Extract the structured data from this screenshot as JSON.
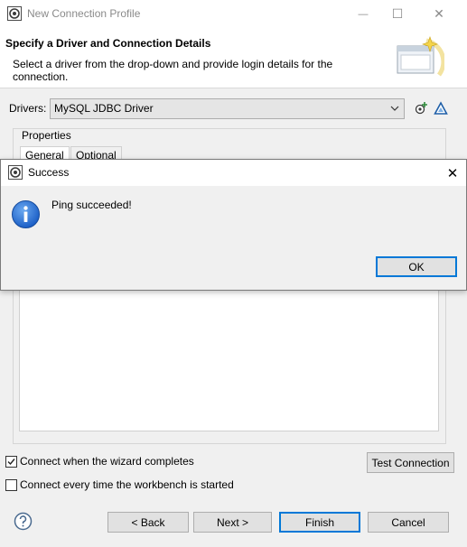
{
  "window": {
    "title": "New Connection Profile",
    "minimize_glyph": "—",
    "maximize_glyph": "☐",
    "close_glyph": "✕"
  },
  "banner": {
    "heading": "Specify a Driver and Connection Details",
    "description": "Select a driver from the drop-down and provide login details for the connection."
  },
  "drivers": {
    "label": "Drivers:",
    "selected": "MySQL JDBC Driver"
  },
  "properties": {
    "label": "Properties",
    "tabs": [
      {
        "label": "General",
        "active": true
      },
      {
        "label": "Optional",
        "active": false
      }
    ]
  },
  "options": {
    "connect_when_complete": {
      "label": "Connect when the wizard completes",
      "checked": true
    },
    "connect_every_time": {
      "label": "Connect every time the workbench is started",
      "checked": false
    }
  },
  "buttons": {
    "test_connection": "Test Connection",
    "back": "< Back",
    "next": "Next >",
    "finish": "Finish",
    "cancel": "Cancel"
  },
  "dialog": {
    "title": "Success",
    "message": "Ping succeeded!",
    "ok": "OK",
    "close_glyph": "✕"
  },
  "colors": {
    "accent": "#0078d7",
    "window_bg": "#f0f0f0",
    "info_blue": "#1c5fc6"
  }
}
